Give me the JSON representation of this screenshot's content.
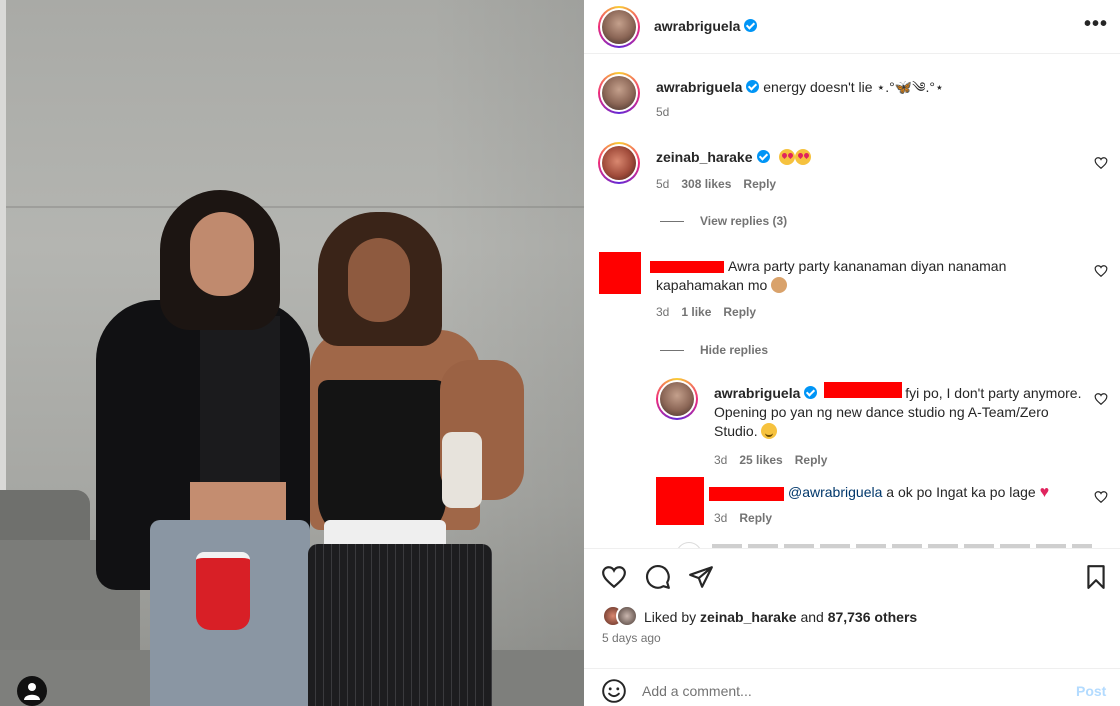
{
  "post": {
    "author": "awrabriguela",
    "more_label": "•••",
    "photo_tag_icon": "user-tag-icon"
  },
  "caption": {
    "username": "awrabriguela",
    "text": "energy doesn't lie ⋆.°🦋༄.°⋆",
    "time": "5d"
  },
  "comments": [
    {
      "username": "zeinab_harake",
      "verified": true,
      "text": "",
      "emojis": "heart-eyes x2",
      "time": "5d",
      "likes": "308 likes",
      "reply": "Reply",
      "replies_toggle": "View replies (3)"
    },
    {
      "username": "",
      "text": "Awra party party kananaman diyan nanaman kapahamakan mo",
      "time": "3d",
      "likes": "1 like",
      "reply": "Reply",
      "replies_toggle": "Hide replies",
      "replies": [
        {
          "username": "awrabriguela",
          "verified": true,
          "text": "fyi po, I don't party anymore. Opening po yan ng new dance studio ng A-Team/Zero Studio.",
          "time": "3d",
          "likes": "25 likes",
          "reply": "Reply"
        },
        {
          "username": "",
          "mention": "@awrabriguela",
          "text": "a ok po Ingat ka po lage",
          "time": "3d",
          "reply": "Reply"
        }
      ]
    }
  ],
  "likes_summary": {
    "prefix": "Liked by",
    "user": "zeinab_harake",
    "middle": "and",
    "others": "87,736 others"
  },
  "posted_ago": "5 days ago",
  "comment_bar": {
    "placeholder": "Add a comment...",
    "post_label": "Post"
  },
  "colors": {
    "accent": "#0095f6",
    "redaction": "#ff0000",
    "muted": "#737373"
  }
}
